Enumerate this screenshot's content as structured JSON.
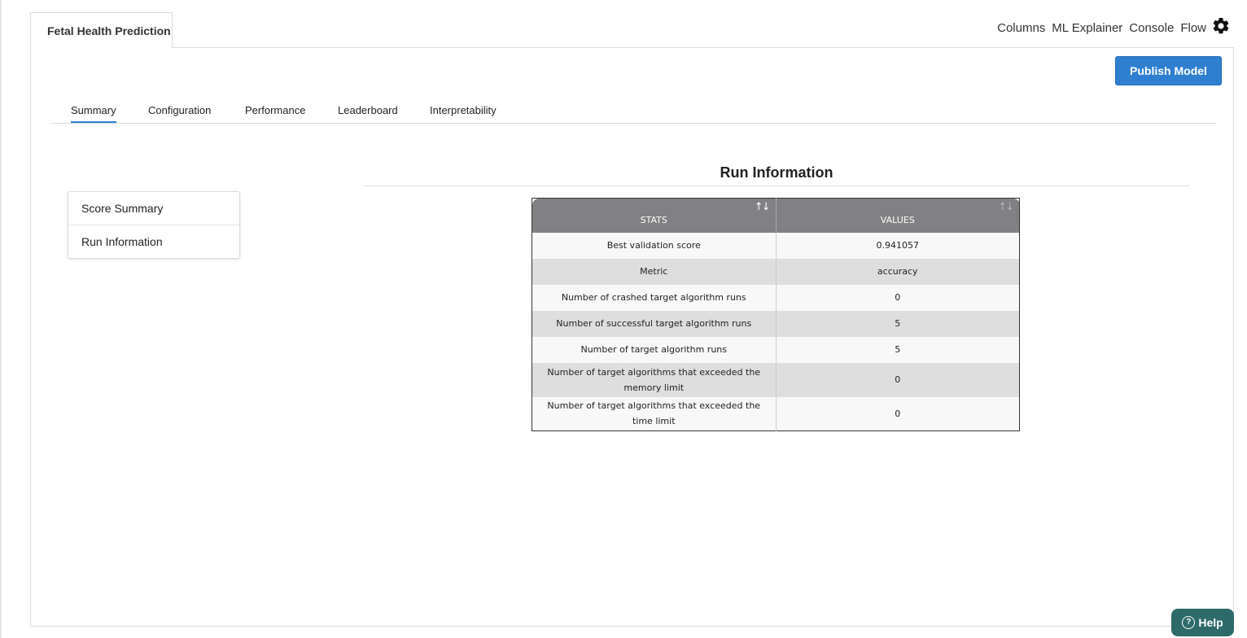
{
  "document_tab": {
    "title": "Fetal Health Prediction"
  },
  "top_links": [
    "Columns",
    "ML Explainer",
    "Console",
    "Flow"
  ],
  "settings_icon": "gear-icon",
  "publish_button": {
    "label": "Publish Model",
    "color": "#2f7fd0"
  },
  "tabs": [
    {
      "label": "Summary",
      "active": true
    },
    {
      "label": "Configuration",
      "active": false
    },
    {
      "label": "Performance",
      "active": false
    },
    {
      "label": "Leaderboard",
      "active": false
    },
    {
      "label": "Interpretability",
      "active": false
    }
  ],
  "side_menu": [
    {
      "label": "Score Summary"
    },
    {
      "label": "Run Information"
    }
  ],
  "section": {
    "title": "Run Information"
  },
  "table": {
    "headers": [
      "STATS",
      "VALUES"
    ],
    "rows": [
      {
        "stat": "Best validation score",
        "value": "0.941057"
      },
      {
        "stat": "Metric",
        "value": "accuracy"
      },
      {
        "stat": "Number of crashed target algorithm runs",
        "value": "0"
      },
      {
        "stat": "Number of successful target algorithm runs",
        "value": "5"
      },
      {
        "stat": "Number of target algorithm runs",
        "value": "5"
      },
      {
        "stat": "Number of target algorithms that exceeded the memory limit",
        "value": "0"
      },
      {
        "stat": "Number of target algorithms that exceeded the time limit",
        "value": "0"
      }
    ]
  },
  "help_button": {
    "label": "Help",
    "color": "#2e6a6a"
  }
}
